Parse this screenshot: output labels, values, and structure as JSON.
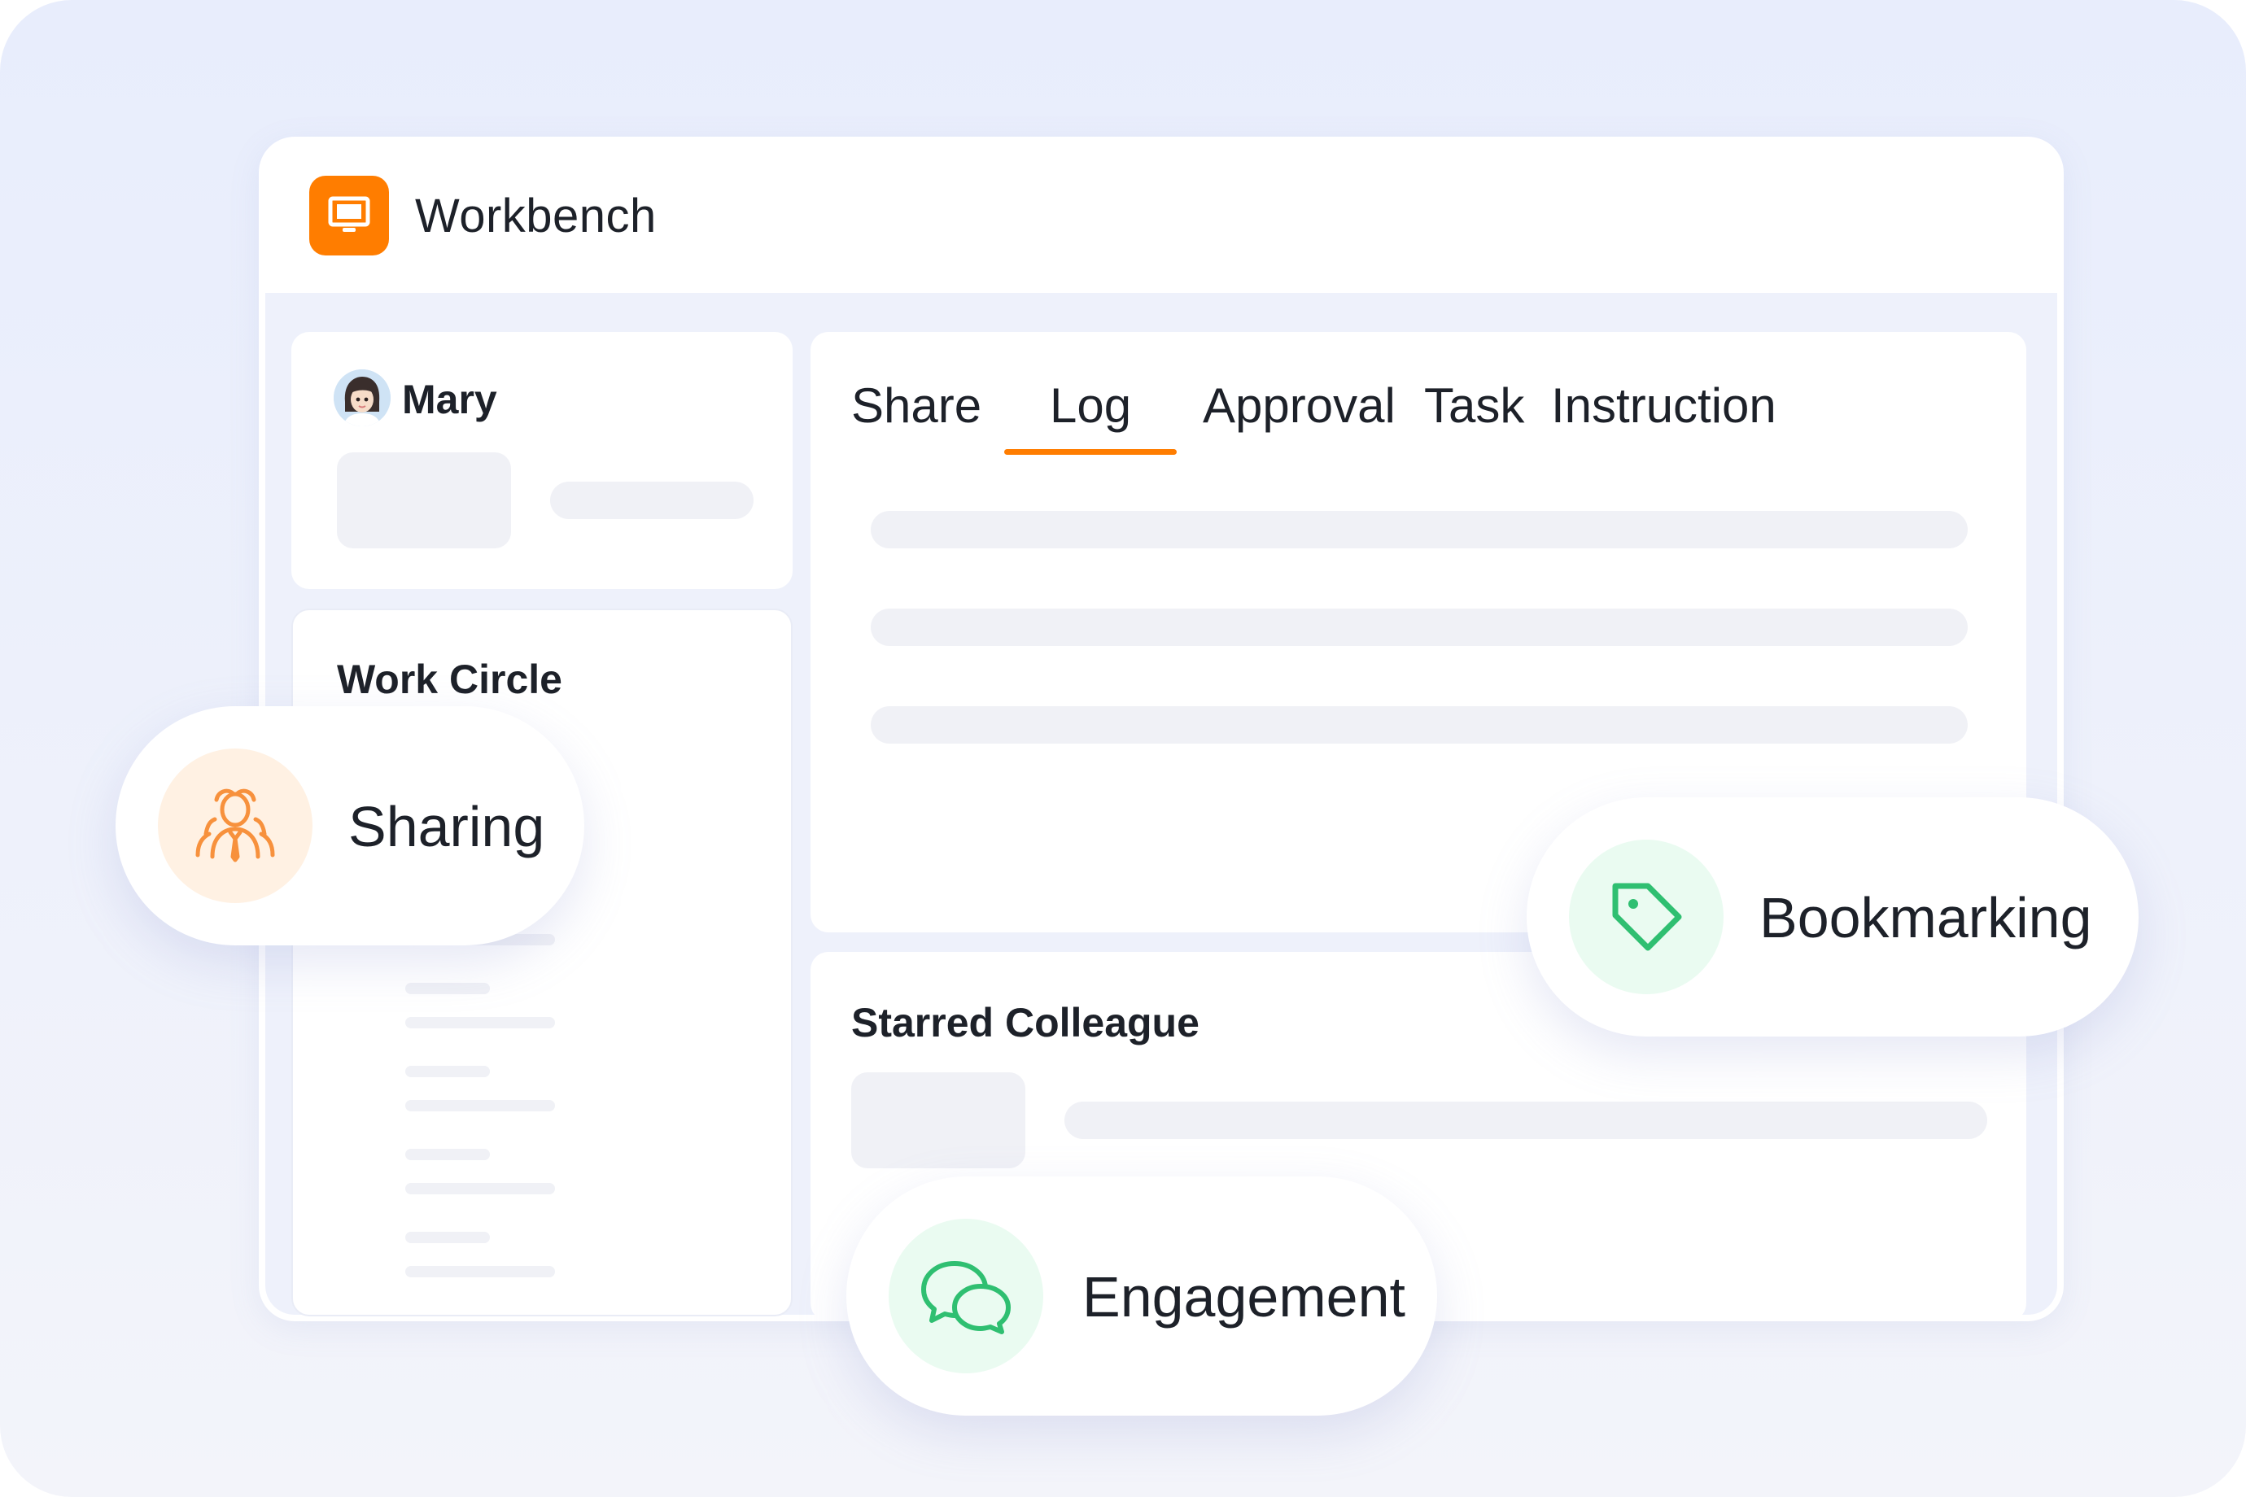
{
  "app": {
    "title": "Workbench"
  },
  "profile": {
    "name": "Mary"
  },
  "work_circle": {
    "title": "Work Circle"
  },
  "tabs": [
    {
      "label": "Share"
    },
    {
      "label": "Log",
      "active": true
    },
    {
      "label": "Approval"
    },
    {
      "label": "Task"
    },
    {
      "label": "Instruction"
    }
  ],
  "starred": {
    "title": "Starred Colleague"
  },
  "features": {
    "sharing": {
      "label": "Sharing",
      "icon": "people-icon",
      "color": "#f7913d",
      "bg": "#fff1e3"
    },
    "bookmarking": {
      "label": "Bookmarking",
      "icon": "tag-icon",
      "color": "#2fbf71",
      "bg": "#eafbf1"
    },
    "engagement": {
      "label": "Engagement",
      "icon": "chat-bubbles-icon",
      "color": "#2fbf71",
      "bg": "#eafbf1"
    }
  },
  "colors": {
    "accent": "#ff7d00",
    "background": "#eef1fb"
  }
}
